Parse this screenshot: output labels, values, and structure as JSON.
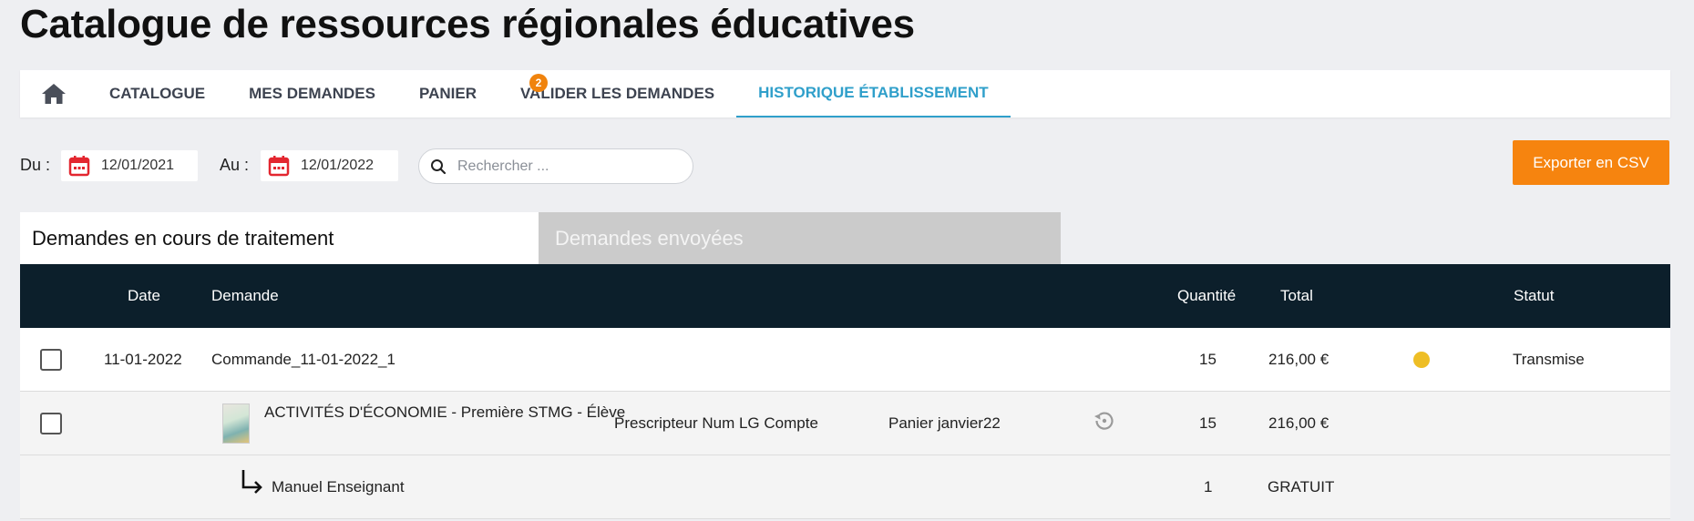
{
  "page": {
    "title": "Catalogue de ressources régionales éducatives"
  },
  "nav": {
    "home_icon": "home-icon",
    "items": [
      {
        "label": "CATALOGUE"
      },
      {
        "label": "MES DEMANDES"
      },
      {
        "label": "PANIER"
      },
      {
        "label": "VALIDER LES DEMANDES",
        "badge": "2"
      },
      {
        "label": "HISTORIQUE ÉTABLISSEMENT",
        "active": true
      }
    ]
  },
  "filters": {
    "from_label": "Du :",
    "from_value": "12/01/2021",
    "to_label": "Au :",
    "to_value": "12/01/2022",
    "search_placeholder": "Rechercher ...",
    "export_label": "Exporter en CSV"
  },
  "tabs": {
    "in_progress": "Demandes en cours de traitement",
    "sent": "Demandes envoyées"
  },
  "table": {
    "headers": {
      "date": "Date",
      "demande": "Demande",
      "quantite": "Quantité",
      "total": "Total",
      "statut": "Statut"
    },
    "order": {
      "date": "11-01-2022",
      "name": "Commande_11-01-2022_1",
      "quantity": "15",
      "total": "216,00 €",
      "status": "Transmise",
      "status_color": "#eebe25"
    },
    "item": {
      "name": "ACTIVITÉS D'ÉCONOMIE - Première STMG - Élève",
      "prescriber": "Prescripteur Num LG Compte",
      "basket": "Panier janvier22",
      "quantity": "15",
      "total": "216,00 €"
    },
    "sub_item": {
      "name": "Manuel Enseignant",
      "quantity": "1",
      "total": "GRATUIT"
    }
  },
  "colors": {
    "accent": "#2f9fca",
    "export": "#f6840f",
    "header_bg": "#0c1f2b",
    "calendar": "#e3262f"
  }
}
